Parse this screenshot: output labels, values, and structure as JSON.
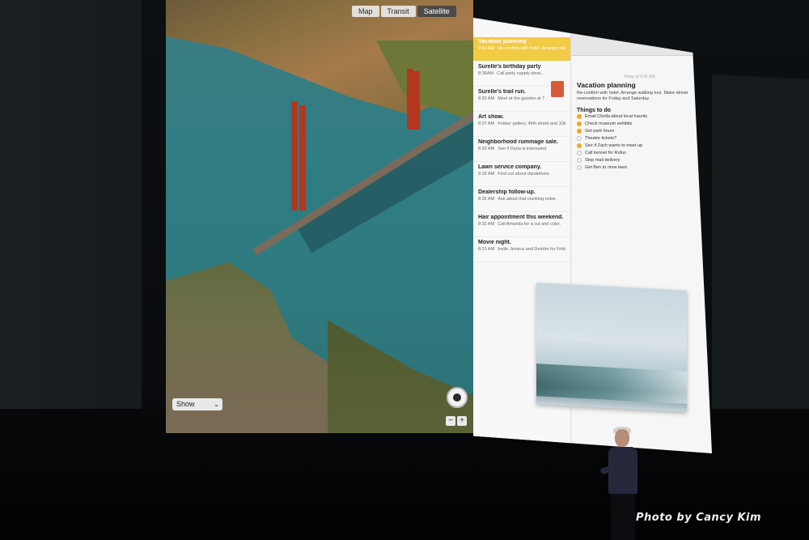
{
  "map": {
    "tabs": [
      "Map",
      "Transit",
      "Satellite"
    ],
    "active_tab": "Satellite",
    "show_label": "Show",
    "zoom_out": "−",
    "zoom_in": "+"
  },
  "notes": {
    "list": [
      {
        "title": "Vacation planning",
        "time": "9:41 AM",
        "preview": "Re-confirm with hotel. Arrange walking..."
      },
      {
        "title": "Surelle's birthday party",
        "time": "8:36AM",
        "preview": "Call party supply store..."
      },
      {
        "title": "Surelle's trail run.",
        "time": "8:32 AM",
        "preview": "Meet at the gazebo at 7"
      },
      {
        "title": "Art show.",
        "time": "8:37 AM",
        "preview": "Fokker gallery, 49th street and 10th av..."
      },
      {
        "title": "Neighborhood rummage sale.",
        "time": "8:32 AM",
        "preview": "See if Darla is interested."
      },
      {
        "title": "Lawn service company.",
        "time": "8:32 AM",
        "preview": "Find out about dandelions."
      },
      {
        "title": "Dealership follow-up.",
        "time": "8:32 AM",
        "preview": "Ask about that clunking noise."
      },
      {
        "title": "Hair appointment this weekend.",
        "time": "8:32 AM",
        "preview": "Call Amanda for a cut and color."
      },
      {
        "title": "Movie night.",
        "time": "8:31 AM",
        "preview": "Invite Jessica and Deirdre for Friday n..."
      }
    ],
    "doc": {
      "meta": "Today at 9:41 AM",
      "title": "Vacation planning",
      "subtitle": "Re-confirm with hotel. Arrange walking tour. Make dinner reservations for Friday and Saturday.",
      "heading": "Things to do",
      "todos": [
        {
          "text": "Email Cholla about local haunts",
          "done": true
        },
        {
          "text": "Check museum exhibits",
          "done": true
        },
        {
          "text": "Get park hours",
          "done": true
        },
        {
          "text": "Theatre tickets?",
          "done": false
        },
        {
          "text": "See if Zach wants to meet up",
          "done": true
        },
        {
          "text": "Call kennel for Rufus",
          "done": false
        },
        {
          "text": "Stop mail delivery",
          "done": false
        },
        {
          "text": "Get Ben to mow lawn",
          "done": false
        }
      ]
    }
  },
  "credit": "Photo by Cancy Kim"
}
